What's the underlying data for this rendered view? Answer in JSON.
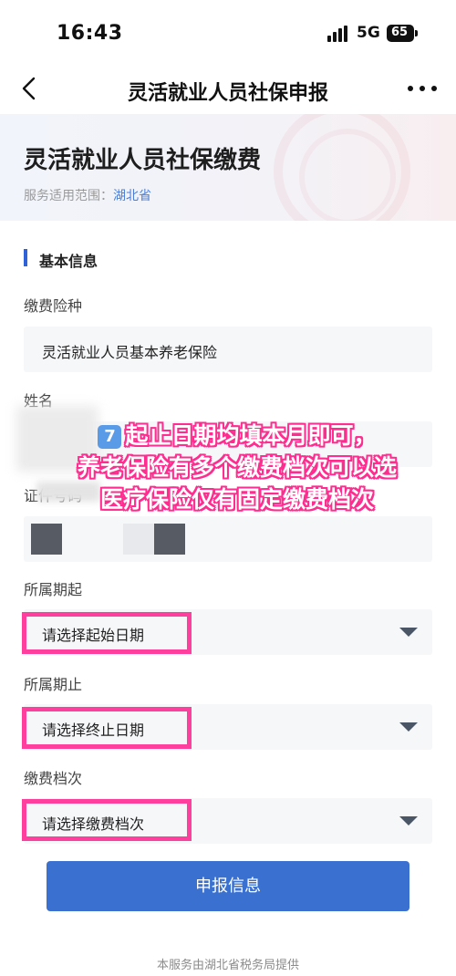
{
  "status_bar": {
    "time": "16:43",
    "network": "5G",
    "battery": "65"
  },
  "nav": {
    "title": "灵活就业人员社保申报",
    "back_icon": "chevron-left-icon",
    "more_icon": "more-dots-icon"
  },
  "banner": {
    "title": "灵活就业人员社保缴费",
    "scope_label": "服务适用范围：",
    "scope_value": "湖北省"
  },
  "section": {
    "title": "基本信息"
  },
  "form": {
    "insurance_type": {
      "label": "缴费险种",
      "value": "灵活就业人员基本养老保险"
    },
    "name": {
      "label": "姓名"
    },
    "id_number": {
      "label": "证件号码"
    },
    "start_period": {
      "label": "所属期起",
      "placeholder": "请选择起始日期"
    },
    "end_period": {
      "label": "所属期止",
      "placeholder": "请选择终止日期"
    },
    "payment_level": {
      "label": "缴费档次",
      "placeholder": "请选择缴费档次"
    }
  },
  "annotation": {
    "badge": "7️⃣",
    "line1": "起止日期均填本月即可，",
    "line2": "养老保险有多个缴费档次可以选",
    "line3": "医疗保险仅有固定缴费档次",
    "color": "#ff2d8f"
  },
  "submit_button": {
    "label": "申报信息"
  },
  "footer": {
    "text": "本服务由湖北省税务局提供"
  },
  "colors": {
    "primary": "#3a70cf",
    "accent": "#2f62d8",
    "highlight": "#ff3f9d"
  }
}
